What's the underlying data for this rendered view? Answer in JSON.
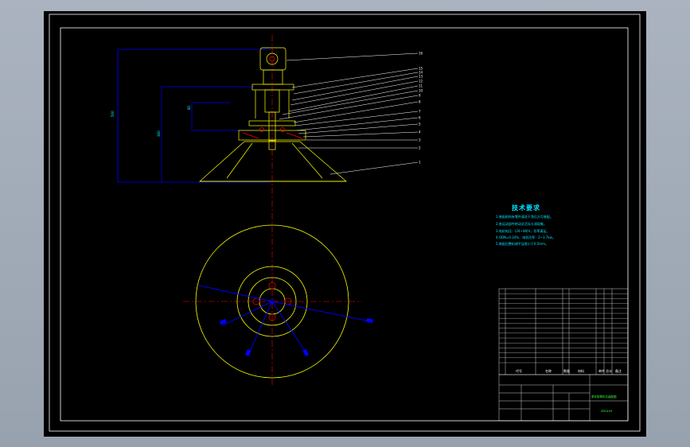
{
  "sheet": {
    "border_color": "#ffffff",
    "background": "#000000"
  },
  "colors": {
    "frame": "#ffffff",
    "part": "#ffff00",
    "dimension": "#0000ff",
    "centerline": "#ff0000",
    "leader": "#ffffff",
    "text_cyan": "#00e5ff",
    "text_green": "#33ff33"
  },
  "balloons": [
    "16",
    "15",
    "14",
    "13",
    "12",
    "11",
    "10",
    "9",
    "8",
    "7",
    "6",
    "5",
    "4",
    "3",
    "2",
    "1"
  ],
  "technical_requirements": {
    "title": "技术要求",
    "items": [
      "1.装配前所有零件清洗干净后方可装配。",
      "2.各运动部件转动灵活无卡滞现象。",
      "3.电机电压：(24~48)V，功率满足。",
      "4.ODN=0.24%，电机功率：2~3.7kw。",
      "5.装配后整机调平误差小于0.5mm。"
    ]
  },
  "title_block": {
    "drawing_name": "草坪割草机总装配图",
    "drawing_number": "ZDHJ-09",
    "header_code": "代号",
    "header_name": "名称",
    "header_qty": "数量",
    "header_material": "材料",
    "header_weight": "单件 总计",
    "header_remark": "备注"
  }
}
